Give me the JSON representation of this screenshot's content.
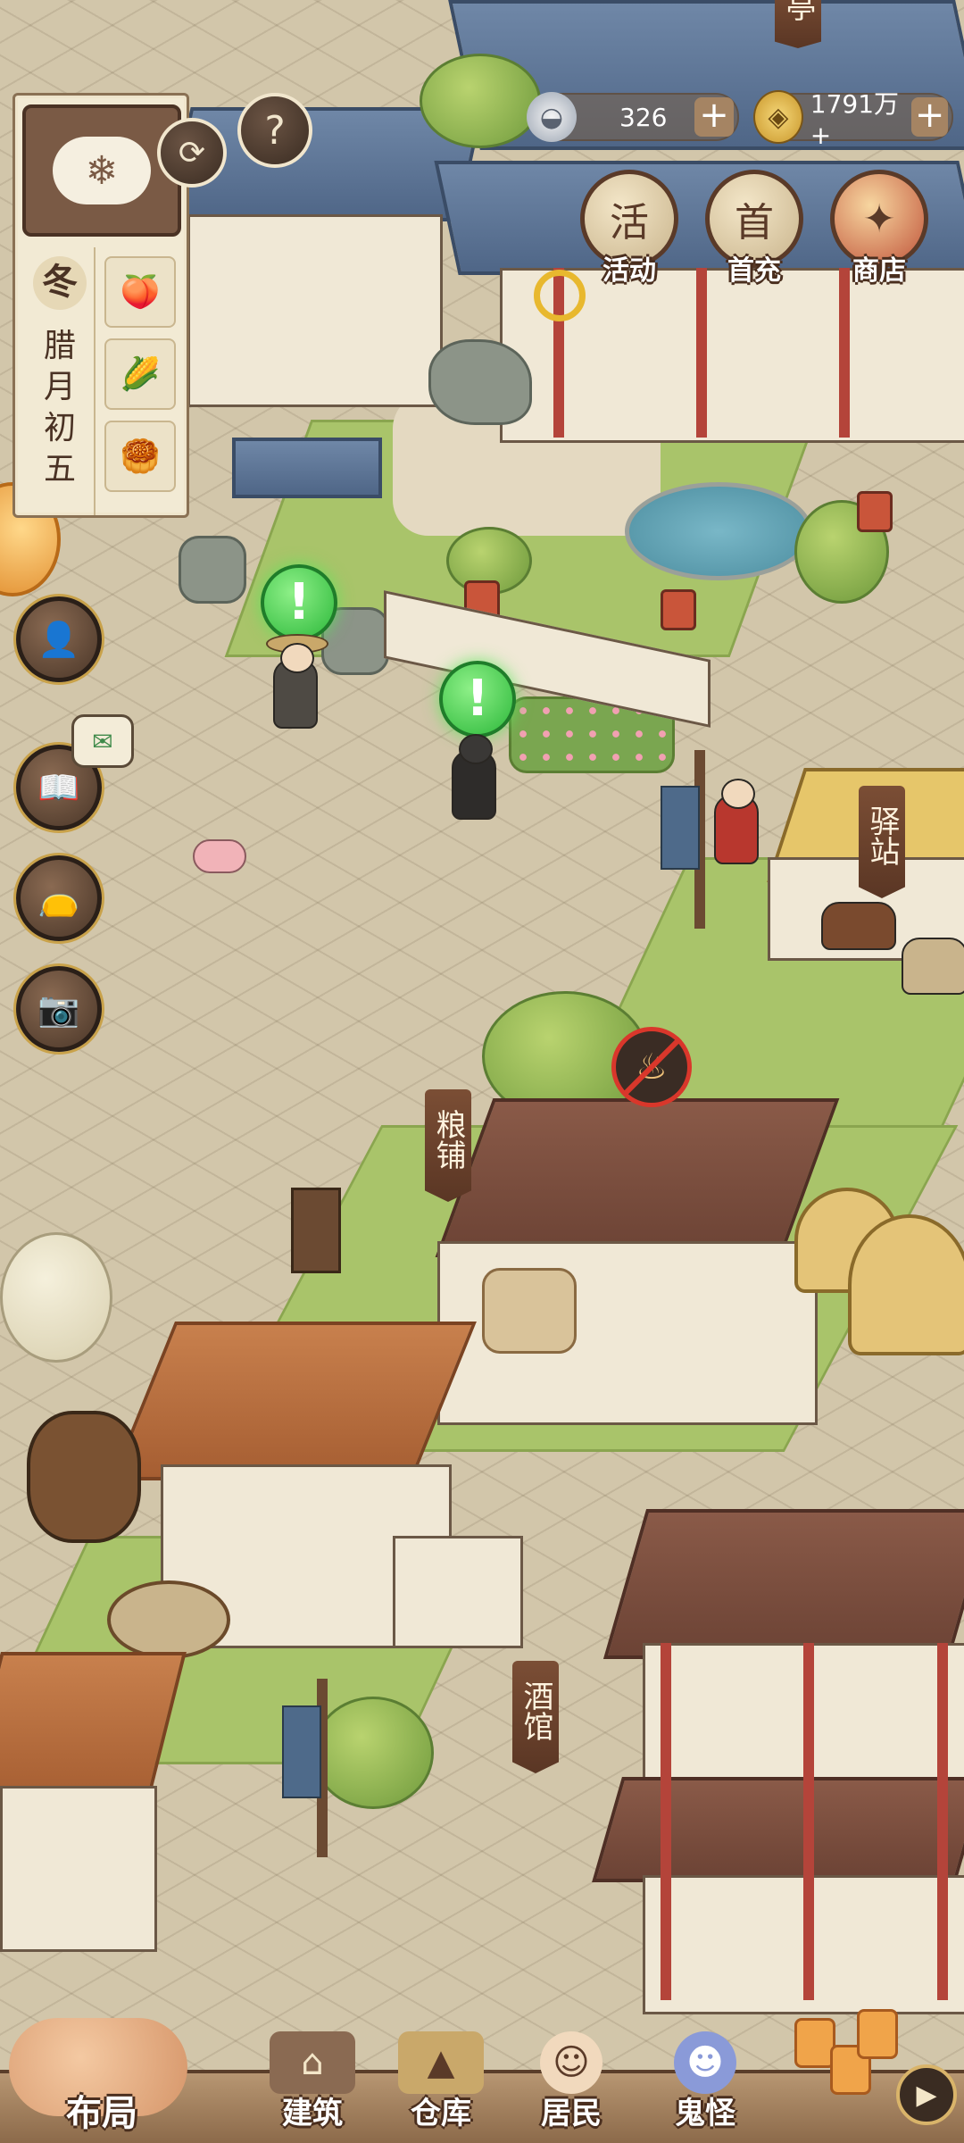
{
  "currency": {
    "silver": {
      "icon": "silver-ingot-icon",
      "value": "326"
    },
    "coin": {
      "icon": "copper-coin-icon",
      "value": "1791万+"
    }
  },
  "top_buttons": [
    {
      "id": "events",
      "label": "活动",
      "icon_text": "活",
      "icon": "scroll-icon"
    },
    {
      "id": "first_recharge",
      "label": "首充",
      "icon_text": "首",
      "icon": "money-bag-icon"
    },
    {
      "id": "shop",
      "label": "商店",
      "icon_text": "",
      "icon": "shop-icon"
    }
  ],
  "calendar": {
    "weather_icon": "snow-cloud-icon",
    "season": "冬",
    "date": "腊月初五",
    "crops": [
      "peach-icon",
      "corn-icon",
      "grain-icon"
    ]
  },
  "building_signs": {
    "top": "亭",
    "post_station": "驿站",
    "grain_shop": "粮铺",
    "tavern": "酒馆"
  },
  "bottom_nav": {
    "layout": "布局",
    "items": [
      {
        "label": "建筑",
        "icon": "building-icon"
      },
      {
        "label": "仓库",
        "icon": "warehouse-icon"
      },
      {
        "label": "居民",
        "icon": "resident-icon"
      },
      {
        "label": "鬼怪",
        "icon": "ghost-icon"
      }
    ]
  },
  "colors": {
    "accent_brown": "#5a3a28",
    "quest_green": "#2cb83a",
    "banned_red": "#d9372b"
  }
}
